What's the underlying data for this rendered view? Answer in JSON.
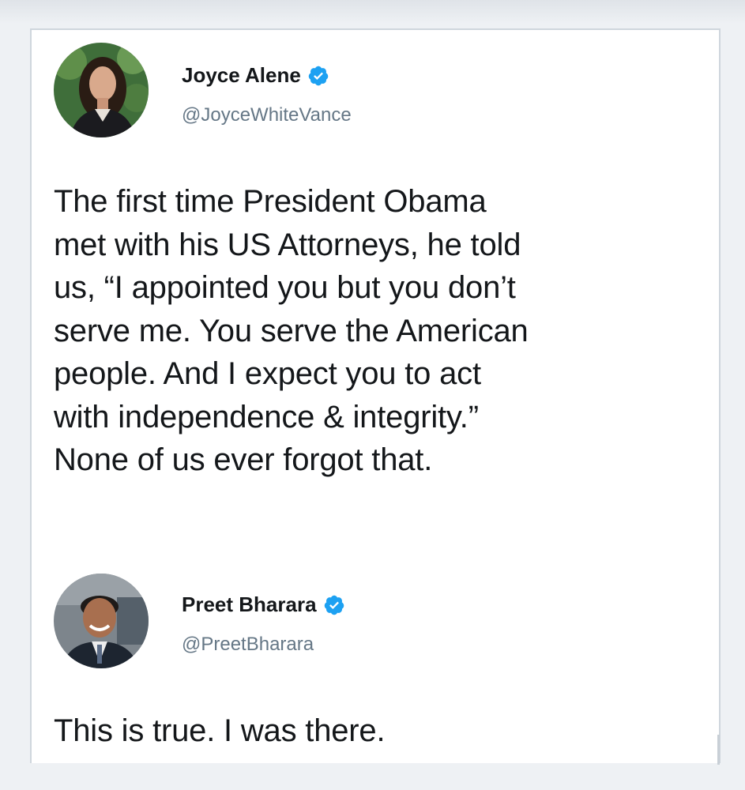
{
  "tweets": [
    {
      "author_name": "Joyce Alene",
      "handle": "@JoyceWhiteVance",
      "text": "The first time President Obama\nmet with his US Attorneys, he told\nus, “I appointed you but you don’t\nserve me. You serve the American\npeople. And I expect you to act\nwith independence & integrity.”\nNone of us ever forgot that.",
      "verified": true
    },
    {
      "author_name": "Preet Bharara",
      "handle": "@PreetBharara",
      "text": "This is true. I was there.",
      "verified": true
    }
  ],
  "colors": {
    "verified_blue": "#1da1f2",
    "handle_gray": "#657786",
    "text": "#14171a"
  },
  "icons": {
    "verified": "verified-badge-icon"
  }
}
